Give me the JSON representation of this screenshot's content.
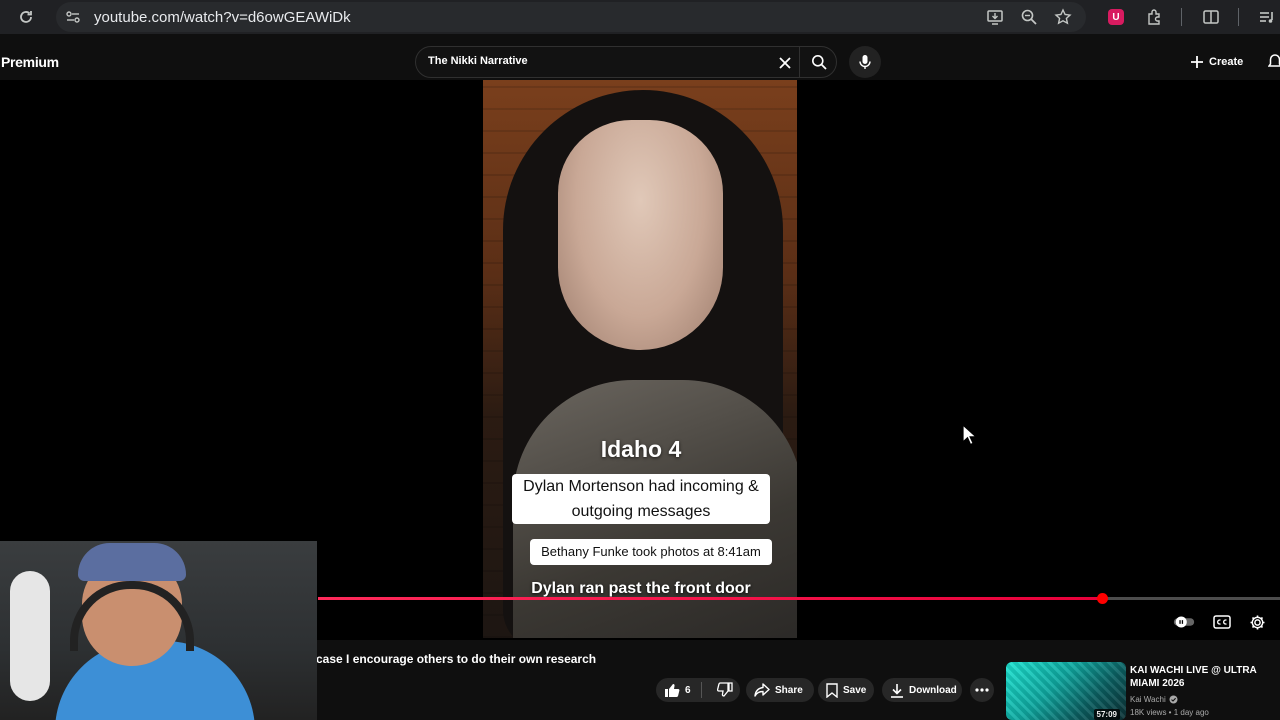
{
  "browser": {
    "url": "youtube.com/watch?v=d6owGEAWiDk",
    "extension_badge": "U"
  },
  "header": {
    "brand": "Premium",
    "search_query": "The Nikki Narrative",
    "create_label": "Create"
  },
  "video": {
    "captions": {
      "heading": "Idaho 4",
      "line1": "Dylan Mortenson had incoming &",
      "line2": "outgoing messages",
      "box2": "Bethany Funke took photos at 8:41am",
      "line3": "Dylan ran past the front door"
    },
    "progress_fraction": 0.815
  },
  "below": {
    "title_fragment": "case I encourage others to do their own research",
    "like_count": "6",
    "share_label": "Share",
    "save_label": "Save",
    "download_label": "Download"
  },
  "recommendation": {
    "title": "KAI WACHI LIVE @ ULTRA MIAMI 2026",
    "channel": "Kai Wachi",
    "meta": "18K views • 1 day ago",
    "duration": "57:09"
  },
  "colors": {
    "progress": "#ff0033",
    "background": "#0f0f0f",
    "pill": "#272727"
  },
  "icons": [
    "reload-icon",
    "site-settings-icon",
    "install-app-icon",
    "zoom-icon",
    "star-icon",
    "extensions-icon",
    "split-view-icon",
    "reading-list-icon",
    "clear-icon",
    "search-icon",
    "mic-icon",
    "plus-icon",
    "bell-icon",
    "autoplay-toggle",
    "captions-icon",
    "settings-icon",
    "like-icon",
    "dislike-icon",
    "share-icon",
    "save-icon",
    "download-icon",
    "more-icon",
    "verified-icon",
    "cursor-icon"
  ]
}
